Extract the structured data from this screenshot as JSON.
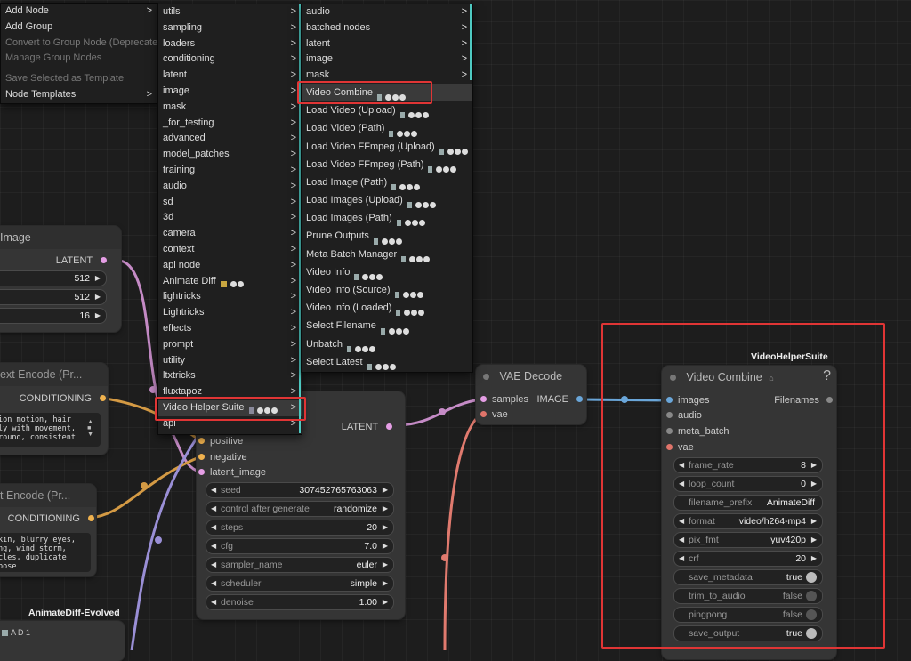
{
  "menu_main": {
    "items": [
      {
        "label": "Add Node",
        "arrow": ">",
        "disabled": false
      },
      {
        "label": "Add Group",
        "arrow": "",
        "disabled": false
      },
      {
        "label": "Convert to Group Node (Deprecated)",
        "arrow": "",
        "disabled": true
      },
      {
        "label": "Manage Group Nodes",
        "arrow": "",
        "disabled": true
      },
      {
        "label": "Save Selected as Template",
        "arrow": "",
        "disabled": true
      },
      {
        "label": "Node Templates",
        "arrow": ">",
        "disabled": false
      }
    ]
  },
  "menu_categories": {
    "items": [
      "utils",
      "sampling",
      "loaders",
      "conditioning",
      "latent",
      "image",
      "mask",
      "_for_testing",
      "advanced",
      "model_patches",
      "training",
      "audio",
      "sd",
      "3d",
      "camera",
      "context",
      "api node",
      "Animate Diff",
      "lightricks",
      "Lightricks",
      "effects",
      "prompt",
      "utility",
      "ltxtricks",
      "fluxtapoz",
      "Video Helper Suite",
      "api"
    ],
    "arrow": ">"
  },
  "menu_vhs": {
    "subcategories": [
      "audio",
      "batched nodes",
      "latent",
      "image",
      "mask"
    ],
    "items": [
      "Video Combine",
      "Load Video (Upload)",
      "Load Video (Path)",
      "Load Video FFmpeg (Upload)",
      "Load Video FFmpeg (Path)",
      "Load Image (Path)",
      "Load Images (Upload)",
      "Load Images (Path)",
      "Prune Outputs",
      "Meta Batch Manager",
      "Video Info",
      "Video Info (Source)",
      "Video Info (Loaded)",
      "Select Filename",
      "Unbatch",
      "Select Latest"
    ],
    "arrow": ">"
  },
  "node_empty_latent": {
    "title": "Image",
    "output": "LATENT",
    "widgets": [
      "512",
      "512",
      "16"
    ]
  },
  "node_text_pos": {
    "title": "ext Encode (Pr...",
    "output": "CONDITIONING",
    "text": "ion motion, hair\nly with movement,\nround, consistent"
  },
  "node_text_neg": {
    "title": "t Encode (Pr...",
    "output": "CONDITIONING",
    "text": "kin, blurry eyes,\nng, wind storm,\ncles, duplicate\npose"
  },
  "node_animatediff": {
    "title": "AnimateDiff-Evolved",
    "badge": "A D 1"
  },
  "node_ksampler": {
    "output": "LATENT",
    "inputs": [
      "positive",
      "negative",
      "latent_image"
    ],
    "widgets": [
      {
        "label": "seed",
        "value": "307452765763063"
      },
      {
        "label": "control after generate",
        "value": "randomize"
      },
      {
        "label": "steps",
        "value": "20"
      },
      {
        "label": "cfg",
        "value": "7.0"
      },
      {
        "label": "sampler_name",
        "value": "euler"
      },
      {
        "label": "scheduler",
        "value": "simple"
      },
      {
        "label": "denoise",
        "value": "1.00"
      }
    ]
  },
  "node_vae_decode": {
    "title": "VAE Decode",
    "inputs": [
      "samples",
      "vae"
    ],
    "output": "IMAGE"
  },
  "node_video_combine": {
    "group_label": "VideoHelperSuite",
    "title": "Video Combine",
    "help": "?",
    "inputs": [
      "images",
      "audio",
      "meta_batch",
      "vae"
    ],
    "output": "Filenames",
    "widgets": [
      {
        "label": "frame_rate",
        "value": "8",
        "type": "number"
      },
      {
        "label": "loop_count",
        "value": "0",
        "type": "number"
      },
      {
        "label": "filename_prefix",
        "value": "AnimateDiff",
        "type": "text"
      },
      {
        "label": "format",
        "value": "video/h264-mp4",
        "type": "combo"
      },
      {
        "label": "pix_fmt",
        "value": "yuv420p",
        "type": "combo"
      },
      {
        "label": "crf",
        "value": "20",
        "type": "number"
      },
      {
        "label": "save_metadata",
        "value": "true",
        "type": "toggle",
        "on": true
      },
      {
        "label": "trim_to_audio",
        "value": "false",
        "type": "toggle",
        "on": false
      },
      {
        "label": "pingpong",
        "value": "false",
        "type": "toggle",
        "on": false
      },
      {
        "label": "save_output",
        "value": "true",
        "type": "toggle",
        "on": true
      }
    ]
  },
  "colors": {
    "latent": "#e59ee5",
    "conditioning": "#f0b24e",
    "image": "#6aa6d9",
    "vae": "#e0746a",
    "highlight": "#e03535",
    "teal": "#4ec9c1"
  }
}
